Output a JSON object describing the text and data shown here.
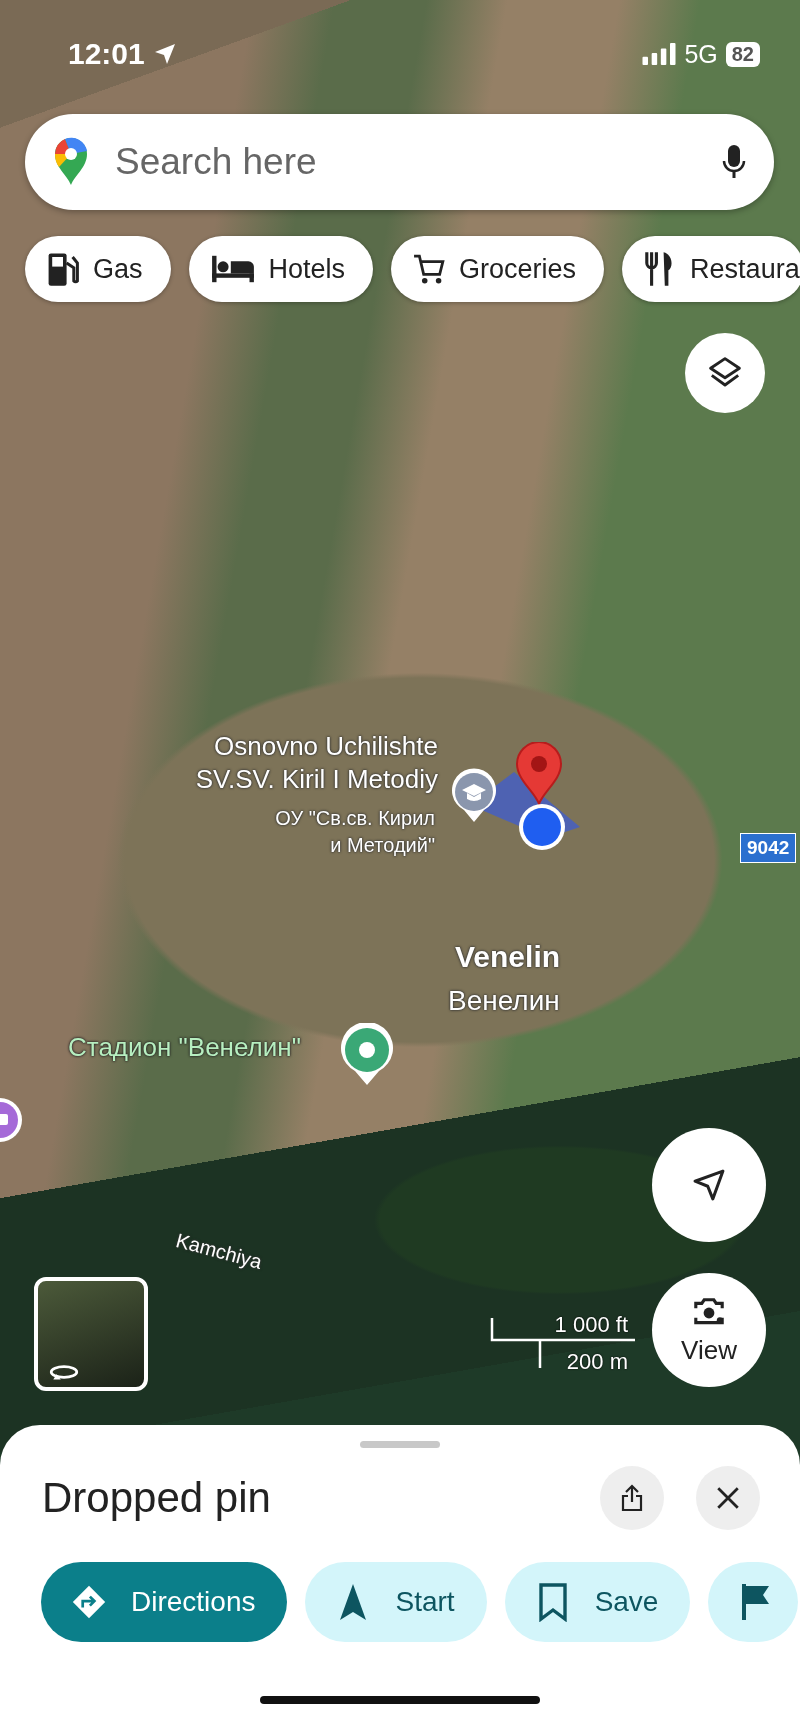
{
  "status_bar": {
    "time": "12:01",
    "network": "5G",
    "battery": "82"
  },
  "search": {
    "placeholder": "Search here"
  },
  "chips": [
    {
      "label": "Gas",
      "kind": "gas"
    },
    {
      "label": "Hotels",
      "kind": "hotels"
    },
    {
      "label": "Groceries",
      "kind": "groceries"
    },
    {
      "label": "Restaura",
      "kind": "restaurants"
    }
  ],
  "map": {
    "labels": [
      {
        "kind": "school",
        "text": "Osnovno Uchilishte\nSV.SV. Kiril I Metodiy"
      },
      {
        "kind": "school_local",
        "text": "ОУ \"Св.св. Кирил\nи Методий\""
      },
      {
        "kind": "road",
        "text": "9042"
      },
      {
        "kind": "town",
        "text": "Venelin"
      },
      {
        "kind": "town_local",
        "text": "Венелин"
      },
      {
        "kind": "stadium",
        "text": "Стадион \"Венелин\""
      },
      {
        "kind": "river",
        "text": "Kamchiya"
      }
    ],
    "scale": {
      "imperial": "1 000 ft",
      "metric": "200 m"
    },
    "view_button": "View"
  },
  "sheet": {
    "title": "Dropped pin",
    "actions": [
      {
        "kind": "directions",
        "label": "Directions",
        "primary": true
      },
      {
        "kind": "start",
        "label": "Start",
        "primary": false
      },
      {
        "kind": "save",
        "label": "Save",
        "primary": false
      },
      {
        "kind": "flag",
        "primary": false
      }
    ]
  }
}
